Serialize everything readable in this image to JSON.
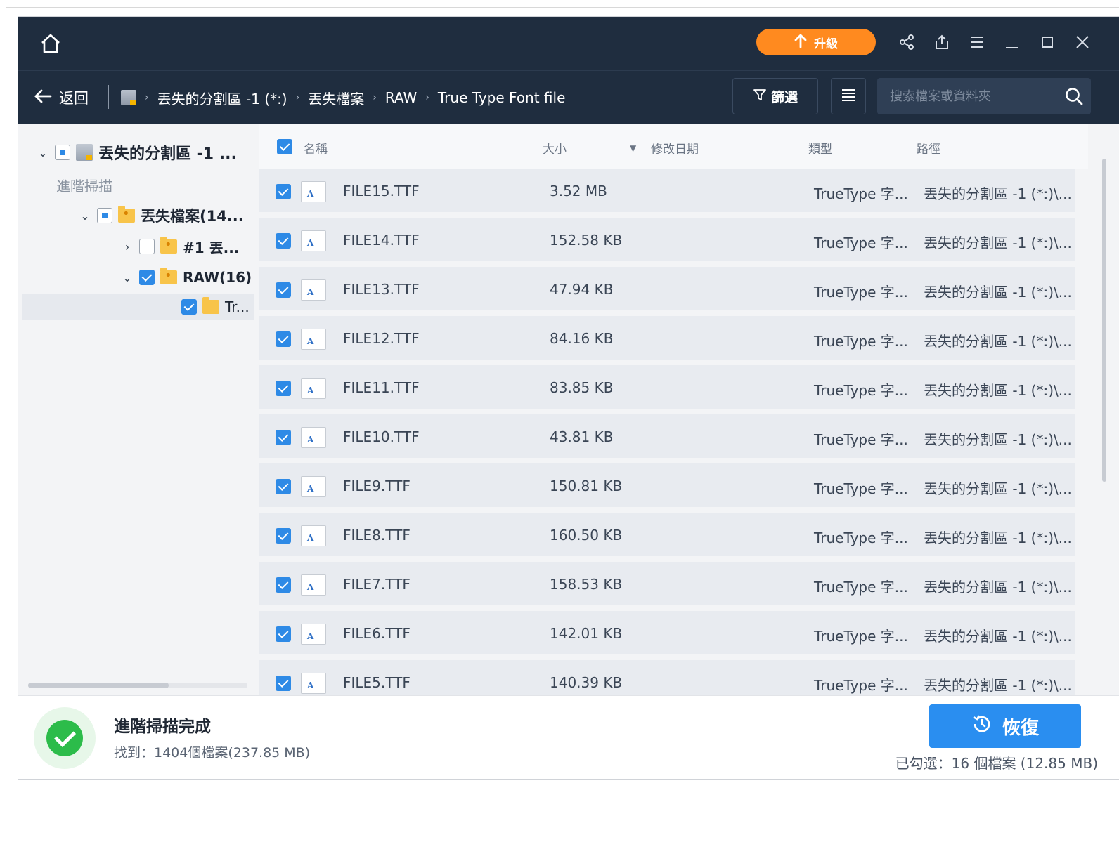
{
  "titlebar": {
    "upgrade_label": "升級",
    "icons": [
      "home-icon",
      "share-icon",
      "export-icon",
      "menu-icon",
      "minimize-icon",
      "maximize-icon",
      "close-icon"
    ]
  },
  "navbar": {
    "back_label": "返回",
    "breadcrumbs": [
      "丟失的分割區 -1 (*:)",
      "丟失檔案",
      "RAW",
      "True Type Font file"
    ],
    "filter_label": "篩選",
    "search_placeholder": "搜索檔案或資料夾"
  },
  "sidebar": {
    "root_label": "丟失的分割區 -1 ...",
    "section_label": "進階掃描",
    "lost_files_label": "丟失檔案(14...",
    "item1_label": "#1 丟...",
    "raw_label": "RAW(16)",
    "tr_label": "Tr..."
  },
  "table": {
    "headers": {
      "name": "名稱",
      "size": "大小",
      "date": "修改日期",
      "type": "類型",
      "path": "路徑"
    },
    "rows": [
      {
        "name": "FILE15.TTF",
        "size": "3.52 MB",
        "type": "TrueType 字...",
        "path": "丟失的分割區 -1 (*:)\\..."
      },
      {
        "name": "FILE14.TTF",
        "size": "152.58 KB",
        "type": "TrueType 字...",
        "path": "丟失的分割區 -1 (*:)\\..."
      },
      {
        "name": "FILE13.TTF",
        "size": "47.94 KB",
        "type": "TrueType 字...",
        "path": "丟失的分割區 -1 (*:)\\..."
      },
      {
        "name": "FILE12.TTF",
        "size": "84.16 KB",
        "type": "TrueType 字...",
        "path": "丟失的分割區 -1 (*:)\\..."
      },
      {
        "name": "FILE11.TTF",
        "size": "83.85 KB",
        "type": "TrueType 字...",
        "path": "丟失的分割區 -1 (*:)\\..."
      },
      {
        "name": "FILE10.TTF",
        "size": "43.81 KB",
        "type": "TrueType 字...",
        "path": "丟失的分割區 -1 (*:)\\..."
      },
      {
        "name": "FILE9.TTF",
        "size": "150.81 KB",
        "type": "TrueType 字...",
        "path": "丟失的分割區 -1 (*:)\\..."
      },
      {
        "name": "FILE8.TTF",
        "size": "160.50 KB",
        "type": "TrueType 字...",
        "path": "丟失的分割區 -1 (*:)\\..."
      },
      {
        "name": "FILE7.TTF",
        "size": "158.53 KB",
        "type": "TrueType 字...",
        "path": "丟失的分割區 -1 (*:)\\..."
      },
      {
        "name": "FILE6.TTF",
        "size": "142.01 KB",
        "type": "TrueType 字...",
        "path": "丟失的分割區 -1 (*:)\\..."
      },
      {
        "name": "FILE5.TTF",
        "size": "140.39 KB",
        "type": "TrueType 字...",
        "path": "丟失的分割區 -1 (*:)\\..."
      }
    ]
  },
  "footer": {
    "status_title": "進階掃描完成",
    "found_text": "找到：1404個檔案(237.85 MB)",
    "recover_label": "恢復",
    "selected_text": "已勾選：16 個檔案 (12.85 MB)"
  },
  "colors": {
    "titlebar_bg": "#1f2d3f",
    "accent": "#2a8ef0",
    "upgrade": "#ff8a1f",
    "success": "#2cbc4a"
  }
}
